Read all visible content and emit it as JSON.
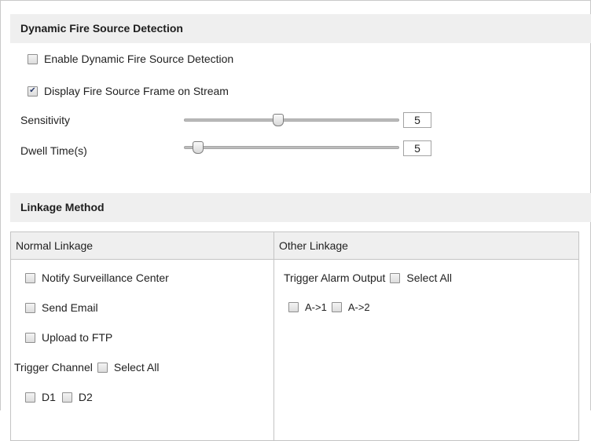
{
  "fire_detection": {
    "title": "Dynamic Fire Source Detection",
    "enable_label": "Enable Dynamic Fire Source Detection",
    "enable_checked": false,
    "display_frame_label": "Display Fire Source Frame on Stream",
    "display_frame_checked": true,
    "sensitivity_label": "Sensitivity",
    "sensitivity_value": "5",
    "dwell_time_label": "Dwell Time(s)",
    "dwell_time_value": "5"
  },
  "linkage": {
    "title": "Linkage Method",
    "normal": {
      "header": "Normal Linkage",
      "notify_label": "Notify Surveillance Center",
      "email_label": "Send Email",
      "ftp_label": "Upload to FTP",
      "trigger_channel_label": "Trigger Channel",
      "select_all_label": "Select All",
      "channels": [
        "D1",
        "D2"
      ]
    },
    "other": {
      "header": "Other Linkage",
      "trigger_alarm_label": "Trigger Alarm Output",
      "select_all_label": "Select All",
      "outputs": [
        "A->1",
        "A->2"
      ]
    }
  }
}
